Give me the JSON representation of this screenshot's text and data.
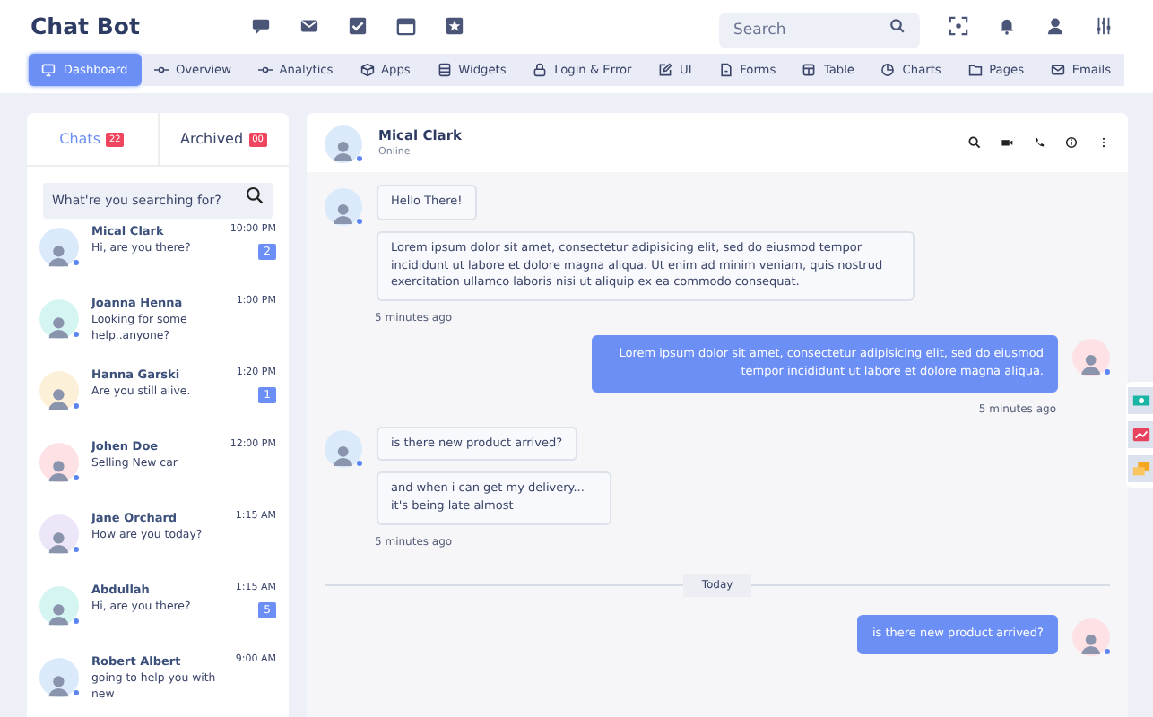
{
  "app_title": "Chat Bot",
  "search": {
    "placeholder": "Search"
  },
  "nav": [
    {
      "label": "Dashboard",
      "selected": true
    },
    {
      "label": "Overview",
      "selected": false
    },
    {
      "label": "Analytics",
      "selected": false
    },
    {
      "label": "Apps",
      "selected": false
    },
    {
      "label": "Widgets",
      "selected": false
    },
    {
      "label": "Login & Error",
      "selected": false
    },
    {
      "label": "UI",
      "selected": false
    },
    {
      "label": "Forms",
      "selected": false
    },
    {
      "label": "Table",
      "selected": false
    },
    {
      "label": "Charts",
      "selected": false
    },
    {
      "label": "Pages",
      "selected": false
    },
    {
      "label": "Emails",
      "selected": false
    }
  ],
  "tabs": [
    {
      "label": "Chats",
      "count": "22",
      "selected": true
    },
    {
      "label": "Archived",
      "count": "00",
      "selected": false
    }
  ],
  "chat_search": {
    "placeholder": "What're you searching for?"
  },
  "chats": [
    {
      "name": "Mical Clark",
      "message": "Hi, are you there?",
      "time": "10:00 PM",
      "unread": "2",
      "color": "#dbeafb"
    },
    {
      "name": "Joanna Henna",
      "message": "Looking for some help..anyone?",
      "time": "1:00 PM",
      "color": "#d5f5f3"
    },
    {
      "name": "Hanna Garski",
      "message": "Are you still alive.",
      "time": "1:20 PM",
      "unread": "1",
      "color": "#fdf0d8"
    },
    {
      "name": "Johen Doe",
      "message": "Selling New car",
      "time": "12:00 PM",
      "color": "#fde1e4"
    },
    {
      "name": "Jane Orchard",
      "message": "How are you today?",
      "time": "1:15 AM",
      "color": "#ece6f8"
    },
    {
      "name": "Abdullah",
      "message": "Hi, are you there?",
      "time": "1:15 AM",
      "unread": "5",
      "color": "#d5f5f3"
    },
    {
      "name": "Robert Albert",
      "message": "going to help you with new",
      "time": "9:00 AM",
      "color": "#dbeafb"
    }
  ],
  "contact": {
    "name": "Mical Clark",
    "status": "Online"
  },
  "messages": [
    {
      "kind": "incoming",
      "bubbles": [
        "Hello There!",
        "Lorem ipsum dolor sit amet, consectetur adipisicing elit, sed do eiusmod tempor incididunt ut labore et dolore magna aliqua. Ut enim ad minim veniam, quis nostrud exercitation ullamco laboris nisi ut aliquip ex ea commodo consequat."
      ],
      "time": "5 minutes ago"
    },
    {
      "kind": "outgoing",
      "bubbles": [
        "Lorem ipsum dolor sit amet, consectetur adipisicing elit, sed do eiusmod tempor incididunt ut labore et dolore magna aliqua."
      ],
      "time": "5 minutes ago"
    },
    {
      "kind": "incoming",
      "bubbles": [
        "is there new product arrived?",
        "and when i can get my delivery... it's being late almost"
      ],
      "time": "5 minutes ago"
    },
    {
      "kind": "divider",
      "label": "Today"
    },
    {
      "kind": "outgoing",
      "bubbles": [
        "is there new product arrived?"
      ]
    }
  ]
}
